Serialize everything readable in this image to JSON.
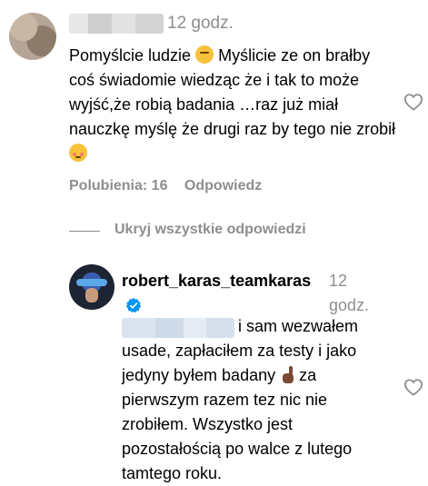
{
  "comment1": {
    "timestamp": "12 godz.",
    "text_parts": [
      "Pomyślcie ludzie",
      "Myślicie ze on brałby coś świadomie wiedząc że i tak to może wyjść,że robią badania …raz już miał nauczkę myślę że drugi raz by tego nie zrobił"
    ],
    "emojis": [
      "thinking-face",
      "flushed-face"
    ],
    "likes_label": "Polubienia: 16",
    "reply_label": "Odpowiedz"
  },
  "replies_toggle": {
    "label": "Ukryj wszystkie odpowiedzi"
  },
  "reply1": {
    "username": "robert_karas_teamkaras",
    "verified": true,
    "timestamp": "12 godz.",
    "text_before_emoji": "i sam wezwałem usade, zapłaciłem za testy i jako jedyny byłem badany",
    "emoji": "index-pointing-up-dark-skin",
    "text_after_emoji": "za pierwszym razem tez nic nie zrobiłem. Wszystko jest pozostałością po walce z lutego tamtego roku."
  },
  "colors": {
    "secondary_text": "#8e8e8e",
    "verified_blue": "#0095f6"
  }
}
